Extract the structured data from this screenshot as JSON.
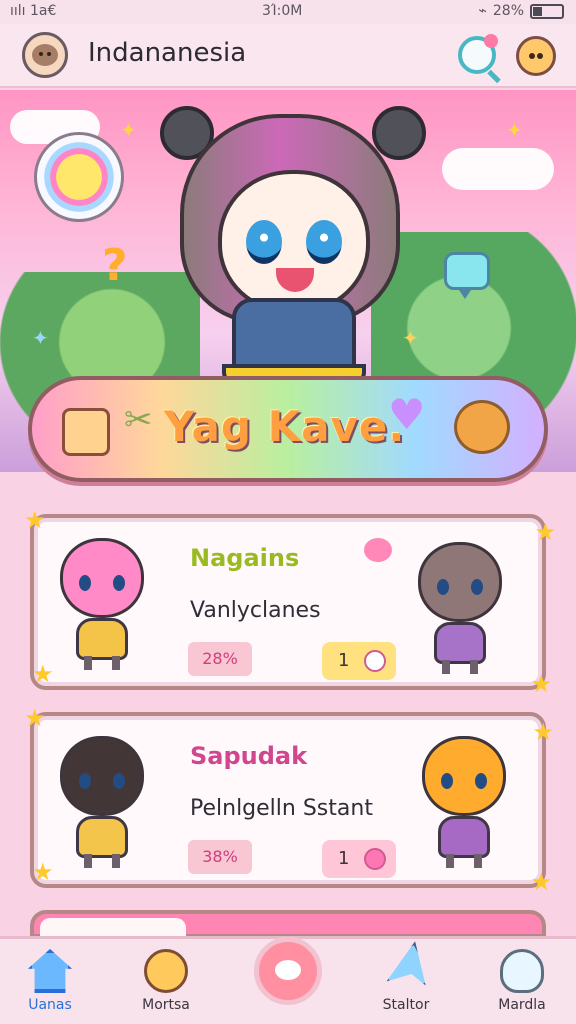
{
  "status_bar": {
    "signal": "ıılı 1a€",
    "time": "3Ί:0M",
    "battery": "28%"
  },
  "app_bar": {
    "title": "Indananesia"
  },
  "banner": {
    "text": "Yag Kave."
  },
  "cards": [
    {
      "title": "Nagains",
      "subtitle": "Vanlyclanes",
      "percent": "28%",
      "count": "1"
    },
    {
      "title": "Sapudak",
      "subtitle": "Pelnlgelln Sstant",
      "percent": "38%",
      "count": "1"
    }
  ],
  "tabs": [
    {
      "label": "Uanas",
      "icon": "home-icon"
    },
    {
      "label": "Mortsa",
      "icon": "pet-icon"
    },
    {
      "label": "",
      "icon": "center-icon"
    },
    {
      "label": "Staltor",
      "icon": "paper-plane-icon"
    },
    {
      "label": "Mardla",
      "icon": "bell-icon"
    }
  ],
  "colors": {
    "accent_pink": "#ff86b2",
    "home_blue": "#2773d8",
    "card_green": "#9aba21",
    "card_pink": "#d0468f"
  }
}
